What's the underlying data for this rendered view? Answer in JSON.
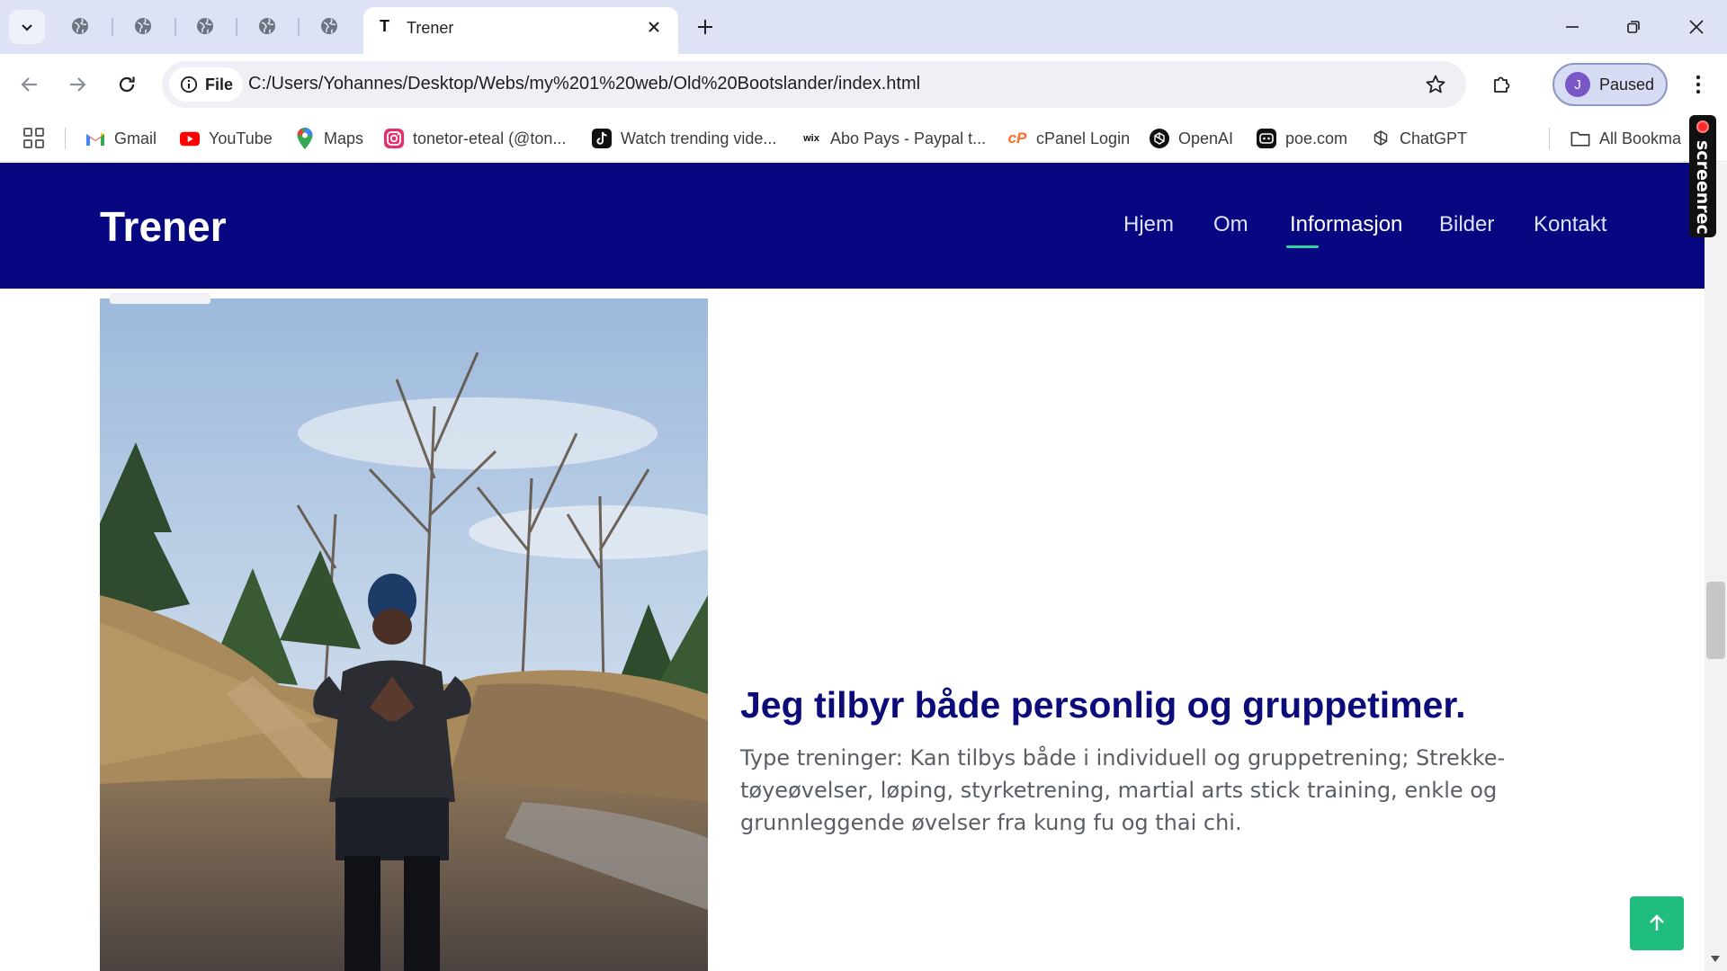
{
  "browser": {
    "active_tab_title": "Trener",
    "active_tab_favicon": "T",
    "new_tab_label": "+",
    "url_chip_label": "File",
    "url": "C:/Users/Yohannes/Desktop/Webs/my%201%20web/Old%20Bootslander/index.html",
    "profile_initial": "J",
    "profile_label": "Paused",
    "bookmarks": [
      {
        "label": "Gmail",
        "icon": "gmail-icon"
      },
      {
        "label": "YouTube",
        "icon": "youtube-icon"
      },
      {
        "label": "Maps",
        "icon": "maps-icon"
      },
      {
        "label": "tonetor-eteal (@ton...",
        "icon": "instagram-icon"
      },
      {
        "label": "Watch trending vide...",
        "icon": "tiktok-icon"
      },
      {
        "label": "Abo Pays - Paypal t...",
        "icon": "wix-icon"
      },
      {
        "label": "cPanel Login",
        "icon": "cpanel-icon"
      },
      {
        "label": "OpenAI",
        "icon": "openai-icon"
      },
      {
        "label": "poe.com",
        "icon": "poe-icon"
      },
      {
        "label": "ChatGPT",
        "icon": "chatgpt-icon"
      },
      {
        "label": "All Bookma",
        "icon": "folder-icon"
      }
    ]
  },
  "site": {
    "brand": "Trener",
    "nav": [
      {
        "label": "Hjem",
        "active": false
      },
      {
        "label": "Om",
        "active": false
      },
      {
        "label": "Informasjon",
        "active": true
      },
      {
        "label": "Bilder",
        "active": false
      },
      {
        "label": "Kontakt",
        "active": false
      }
    ],
    "heading": "Jeg tilbyr både personlig og gruppetimer.",
    "body": "Type treninger: Kan tilbys både i individuell og gruppetrening; Strekke-tøyeøvelser, løping, styrketrening, martial arts stick training, enkle og grunnleggende øvelser fra kung fu og thai chi.",
    "colors": {
      "nav_background": "#070782",
      "heading": "#0b0b7a",
      "accent": "#1fbd7e"
    }
  },
  "overlay": {
    "recorder_label": "screenrec"
  }
}
